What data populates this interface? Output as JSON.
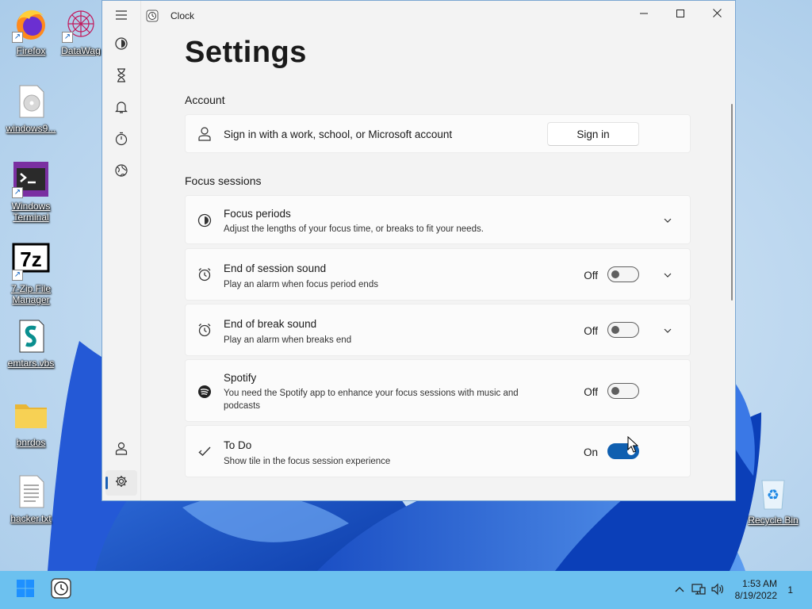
{
  "desktop": {
    "icons": [
      {
        "label": "Firefox",
        "icon": "firefox-icon"
      },
      {
        "label": "DataWag",
        "icon": "datawag-icon"
      },
      {
        "label": "windows9...",
        "icon": "disc-image-file-icon"
      },
      {
        "label": "Windows Terminal",
        "icon": "terminal-icon"
      },
      {
        "label": "7-Zip File Manager",
        "icon": "7zip-icon"
      },
      {
        "label": "emtars.vbs",
        "icon": "script-file-icon"
      },
      {
        "label": "bnrdos",
        "icon": "folder-icon"
      },
      {
        "label": "hacker.txt",
        "icon": "text-file-icon"
      },
      {
        "label": "Recycle Bin",
        "icon": "recycle-bin-icon"
      }
    ]
  },
  "window": {
    "title": "Clock",
    "controls": {
      "minimize": "minimize-icon",
      "maximize": "maximize-icon",
      "close": "close-icon"
    }
  },
  "nav": {
    "items": [
      {
        "name": "menu",
        "icon": "hamburger-icon"
      },
      {
        "name": "focus-sessions",
        "icon": "focus-icon"
      },
      {
        "name": "timer",
        "icon": "hourglass-icon"
      },
      {
        "name": "alarm",
        "icon": "bell-icon"
      },
      {
        "name": "stopwatch",
        "icon": "stopwatch-icon"
      },
      {
        "name": "world-clock",
        "icon": "globe-icon"
      },
      {
        "name": "account",
        "icon": "person-icon"
      },
      {
        "name": "settings",
        "icon": "gear-icon",
        "active": true
      }
    ]
  },
  "settings": {
    "title": "Settings",
    "account_section": "Account",
    "account_text": "Sign in with a work, school, or Microsoft account",
    "signin_label": "Sign in",
    "focus_section": "Focus sessions",
    "focus_periods": {
      "title": "Focus periods",
      "desc": "Adjust the lengths of your focus time, or breaks to fit your needs."
    },
    "end_session_sound": {
      "title": "End of session sound",
      "desc": "Play an alarm when focus period ends",
      "state": "Off",
      "on": false
    },
    "end_break_sound": {
      "title": "End of break sound",
      "desc": "Play an alarm when breaks end",
      "state": "Off",
      "on": false
    },
    "spotify": {
      "title": "Spotify",
      "desc": "You need the Spotify app to enhance your focus sessions with music and podcasts",
      "state": "Off",
      "on": false
    },
    "todo": {
      "title": "To Do",
      "desc": "Show tile in the focus session experience",
      "state": "On",
      "on": true
    }
  },
  "taskbar": {
    "time": "1:53 AM",
    "date": "8/19/2022",
    "notification_count": "1"
  },
  "colors": {
    "accent": "#0f5fb0",
    "taskbar": "#6cc1ef",
    "window_bg": "#f3f3f3"
  }
}
